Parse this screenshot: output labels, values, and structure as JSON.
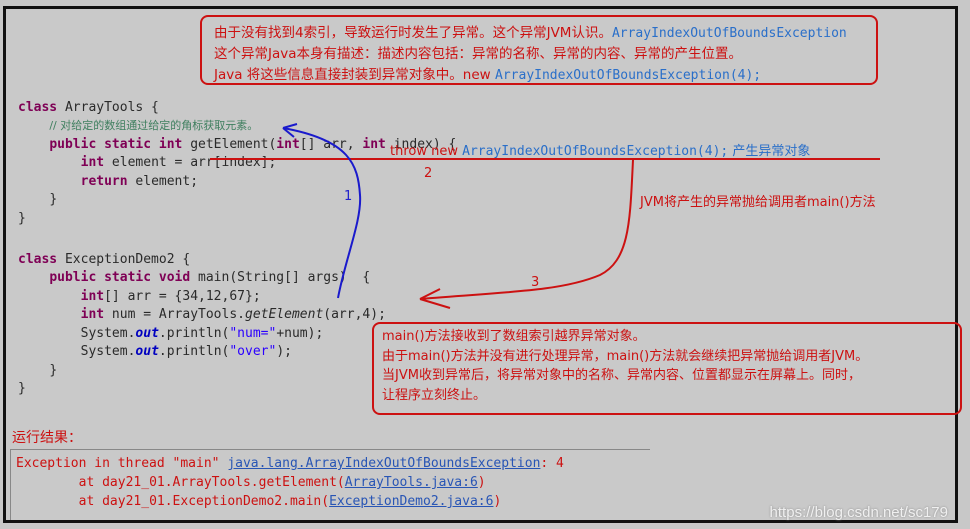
{
  "annotation_top": {
    "line1_text": "由于没有找到4索引，导致运行时发生了异常。这个异常JVM认识。",
    "line1_code": "ArrayIndexOutOfBoundsException",
    "line2_text": "这个异常Java本身有描述：描述内容包括：异常的名称、异常的内容、异常的产生位置。",
    "line3_text": "Java 将这些信息直接封装到异常对象中。new ",
    "line3_code": "ArrayIndexOutOfBoundsException(4);"
  },
  "code_arraytools": {
    "line1": "class ArrayTools {",
    "comment": "// 对给定的数组通过给定的角标获取元素。",
    "line_sig_pre": "public static int",
    "line_sig_name": " getElement(",
    "line_sig_kw1": "int",
    "line_sig_mid": "[] arr, ",
    "line_sig_kw2": "int",
    "line_sig_end": " index) {",
    "line_elem_kw": "int",
    "line_elem_rest": " element = arr[index];",
    "line_ret_kw": "return",
    "line_ret_rest": " element;",
    "close_inner": "}",
    "close_outer": "}"
  },
  "code_demo": {
    "line1": "class ExceptionDemo2 {",
    "sig_kw": "public static void",
    "sig_rest": " main(String[] args)  {",
    "arr_kw": "int",
    "arr_rest": "[] arr = {34,12,67};",
    "num_kw": "int",
    "num_mid": " num = ArrayTools.",
    "num_method": "getElement",
    "num_end": "(arr,4);",
    "p1_pre": "System.",
    "p1_field": "out",
    "p1_mid": ".println(",
    "p1_str": "\"num=\"",
    "p1_end": "+num);",
    "p2_pre": "System.",
    "p2_field": "out",
    "p2_mid": ".println(",
    "p2_str": "\"over\"",
    "p2_end": ");",
    "close_inner": "}",
    "close_outer": "}"
  },
  "throw_line": {
    "prefix": "throw new ",
    "code": "ArrayIndexOutOfBoundsException(4);",
    "suffix": " 产生异常对象"
  },
  "labels": {
    "step1": "1",
    "step2": "2",
    "step3": "3",
    "jvm_throw": "JVM将产生的异常抛给调用者main()方法"
  },
  "annotation_main": {
    "line1": "main()方法接收到了数组索引越界异常对象。",
    "line2": "由于main()方法并没有进行处理异常，main()方法就会继续把异常抛给调用者JVM。",
    "line3": "当JVM收到异常后，将异常对象中的名称、异常内容、位置都显示在屏幕上。同时，",
    "line4": "让程序立刻终止。"
  },
  "result": {
    "title": "运行结果：",
    "line1_pre": "Exception in thread \"main\" ",
    "line1_link": "java.lang.ArrayIndexOutOfBoundsException",
    "line1_post": ": 4",
    "line2_pre": "\tat day21_01.ArrayTools.getElement(",
    "line2_link": "ArrayTools.java:6",
    "line2_post": ")",
    "line3_pre": "\tat day21_01.ExceptionDemo2.main(",
    "line3_link": "ExceptionDemo2.java:6",
    "line3_post": ")"
  },
  "watermark": "https://blog.csdn.net/sc179",
  "colors": {
    "annotation_red": "#cc1111",
    "arrow_blue": "#1a1acc",
    "code_blue": "#2a6fc9",
    "keyword": "#7f0055",
    "link": "#2855b5",
    "background": "#c9c9c9"
  }
}
